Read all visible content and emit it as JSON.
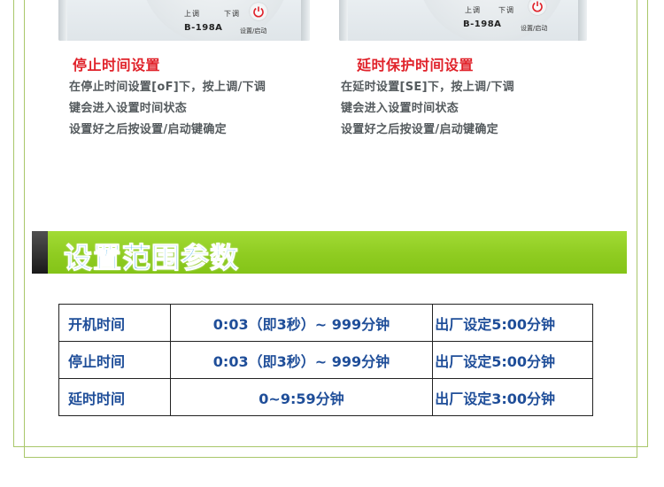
{
  "devices": [
    {
      "up_label": "上调",
      "down_label": "下调",
      "model": "B-198A",
      "set_label": "设置/启动",
      "power_icon": "power-icon"
    },
    {
      "up_label": "上调",
      "down_label": "下调",
      "model": "B-198A",
      "set_label": "设置/启动",
      "power_icon": "power-icon"
    }
  ],
  "sections": [
    {
      "title": "停止时间设置",
      "lines": [
        "在停止时间设置[oF]下，按上调/下调",
        "键会进入设置时间状态",
        "设置好之后按设置/启动键确定"
      ]
    },
    {
      "title": "延时保护时间设置",
      "lines": [
        "在延时设置[SE]下，按上调/下调",
        "键会进入设置时间状态",
        "设置好之后按设置/启动键确定"
      ]
    }
  ],
  "banner": {
    "title": "设置范围参数"
  },
  "table": {
    "rows": [
      {
        "name": "开机时间",
        "range": "0:03（即3秒）~ 999分钟",
        "default": "出厂设定5:00分钟"
      },
      {
        "name": "停止时间",
        "range": "0:03（即3秒）~ 999分钟",
        "default": "出厂设定5:00分钟"
      },
      {
        "name": "延时时间",
        "range": "0~9:59分钟",
        "default": "出厂设定3:00分钟"
      }
    ]
  },
  "colors": {
    "section_title": "#e0222a",
    "description_text": "#555b5e",
    "banner_green": "#8fcc21",
    "banner_title": "#2fa6ea",
    "table_text": "#1f4e99",
    "frame_green": "#a9c76a"
  }
}
